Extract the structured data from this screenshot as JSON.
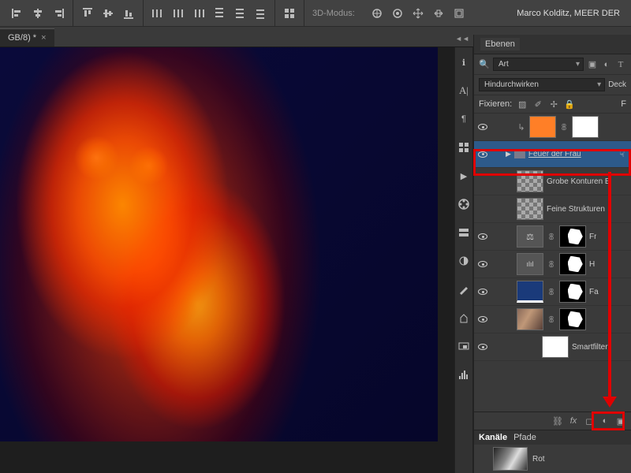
{
  "topbar": {
    "mode_label": "3D-Modus:"
  },
  "doc_title": "Marco Kolditz, MEER DER",
  "tab": {
    "name": "GB/8) *"
  },
  "panel": {
    "title": "Ebenen",
    "search_kind": "Art",
    "blend_mode": "Hindurchwirken",
    "opacity_label": "Deck",
    "fix_label": "Fixieren:",
    "fill_label": "F"
  },
  "layers": [
    {
      "name": "",
      "vis": true,
      "type": "fill-orange"
    },
    {
      "name": "Feuer der Frau",
      "vis": true,
      "type": "group",
      "selected": true
    },
    {
      "name": "Grobe Konturen B",
      "vis": false,
      "type": "checker",
      "indent": 1
    },
    {
      "name": "Feine Strukturen",
      "vis": false,
      "type": "checker",
      "indent": 1
    },
    {
      "name": "Fr",
      "vis": true,
      "type": "balance-mask",
      "indent": 1
    },
    {
      "name": "H",
      "vis": true,
      "type": "levels-mask",
      "indent": 1
    },
    {
      "name": "Fa",
      "vis": true,
      "type": "blue-mask",
      "indent": 1
    },
    {
      "name": "",
      "vis": true,
      "type": "photo-mask",
      "indent": 1
    },
    {
      "name": "Smartfilter",
      "vis": true,
      "type": "smartfilter",
      "indent": 2
    }
  ],
  "bottom": {
    "tabs": [
      "Kanäle",
      "Pfade"
    ],
    "channel": "Rot"
  }
}
